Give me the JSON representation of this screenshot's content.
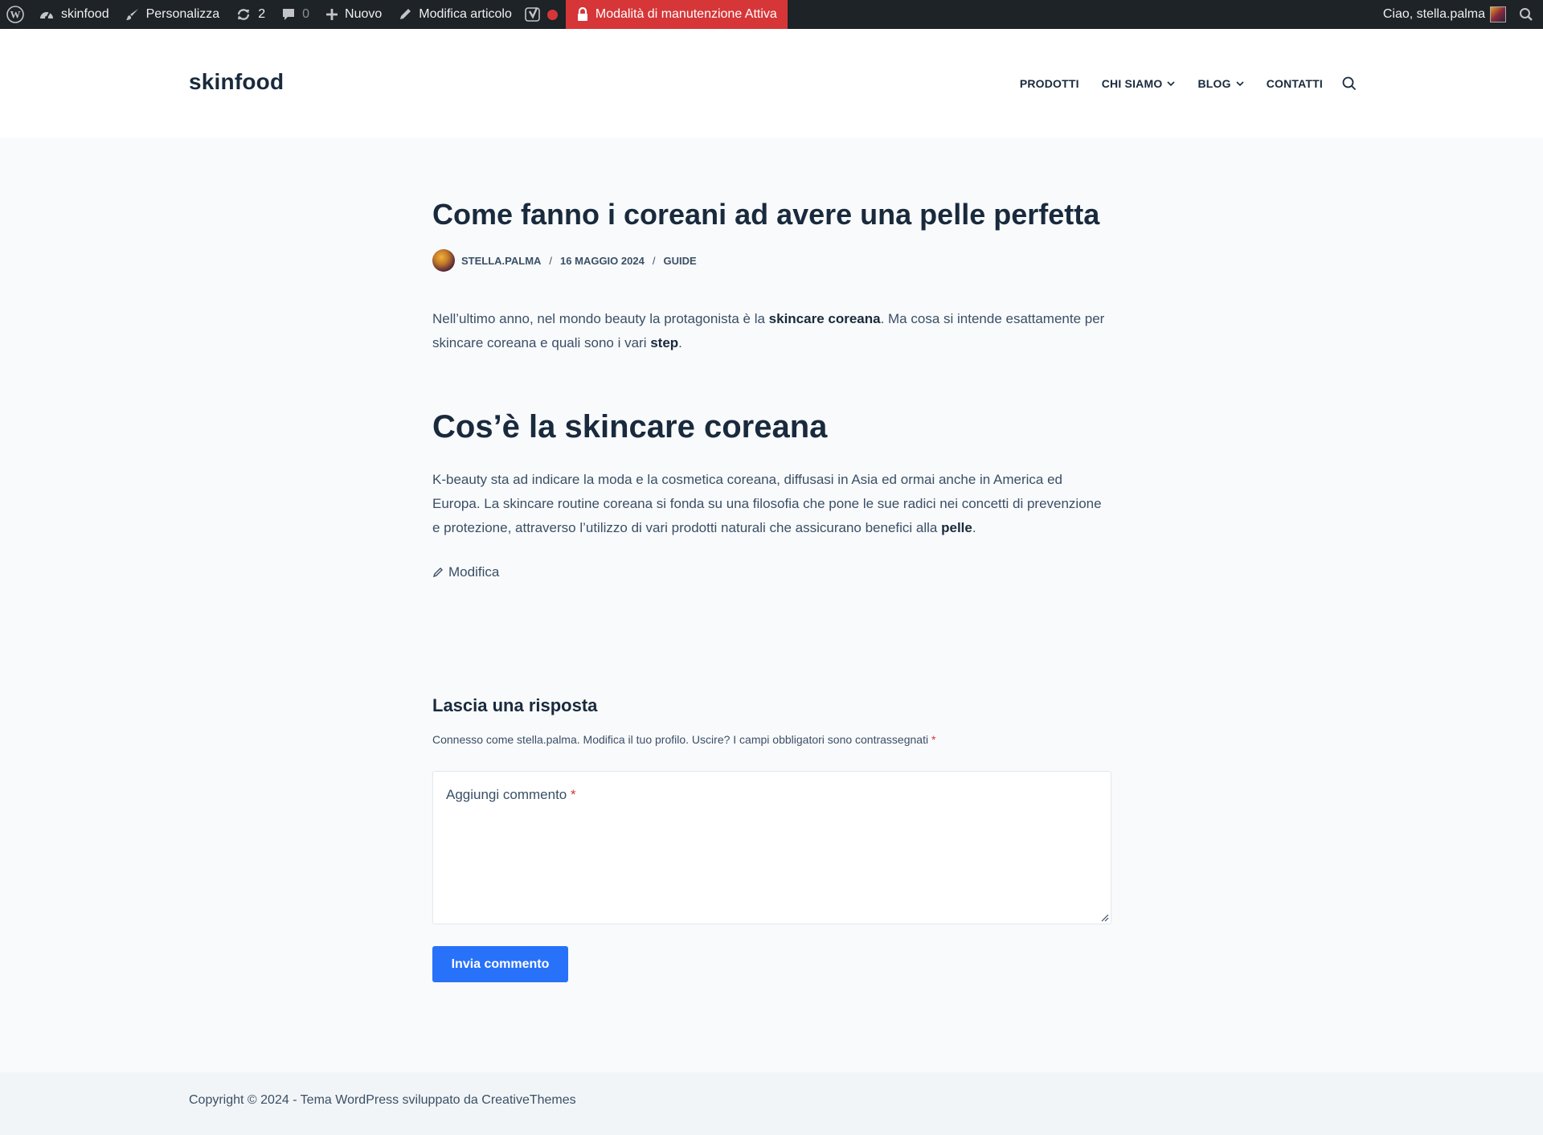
{
  "adminbar": {
    "site": "skinfood",
    "customize": "Personalizza",
    "updates_count": "2",
    "comments_count": "0",
    "new": "Nuovo",
    "edit_post": "Modifica articolo",
    "maintenance": "Modalità di manutenzione Attiva",
    "greeting": "Ciao, stella.palma"
  },
  "header": {
    "site_title": "skinfood",
    "nav": [
      {
        "label": "PRODOTTI"
      },
      {
        "label": "CHI SIAMO"
      },
      {
        "label": "BLOG"
      },
      {
        "label": "CONTATTI"
      }
    ]
  },
  "article": {
    "title": "Come fanno i coreani ad avere una pelle perfetta",
    "meta": {
      "author": "STELLA.PALMA",
      "date": "16 MAGGIO 2024",
      "category": "GUIDE",
      "separator": "/"
    },
    "p1": {
      "t1": "Nell’ultimo anno, nel mondo beauty la protagonista è la ",
      "b1": "skincare coreana",
      "t2": ". Ma cosa si intende esattamente per skincare coreana e quali sono i vari ",
      "b2": "step",
      "t3": "."
    },
    "heading": "Cos’è la skincare coreana",
    "p2": {
      "t1": "K-beauty sta ad indicare la moda e la cosmetica coreana, diffusasi in Asia ed ormai anche in America ed Europa. La skincare routine coreana si fonda su una filosofia che pone le sue radici nei concetti di prevenzione e protezione, attraverso l’utilizzo di vari prodotti naturali che assicurano benefici alla ",
      "b1": "pelle",
      "t2": "."
    },
    "edit_link": "Modifica"
  },
  "comments": {
    "title": "Lascia una risposta",
    "logged_in": "Connesso come stella.palma. Modifica il tuo profilo. Uscire? I campi obbligatori sono contrassegnati",
    "required_mark": "*",
    "textarea_placeholder": "Aggiungi commento",
    "submit": "Invia commento"
  },
  "footer": {
    "copyright": "Copyright © 2024 - Tema WordPress sviluppato da CreativeThemes"
  },
  "colors": {
    "adminbar_bg": "#1d2327",
    "maintenance_bg": "#d63638",
    "heading": "#192a3d",
    "text": "#3a4f66",
    "button": "#2872fa",
    "page_bg": "#f9fafb",
    "footer_bg": "#f2f5f7"
  },
  "icons": {
    "wordpress": "wordpress-icon",
    "dashboard": "dashboard-icon",
    "customize": "brush-icon",
    "updates": "refresh-icon",
    "comments": "comment-bubble-icon",
    "new": "plus-icon",
    "edit": "pencil-icon",
    "yoast": "yoast-icon",
    "status": "red-dot-icon",
    "lock": "lock-icon",
    "search": "search-icon"
  }
}
